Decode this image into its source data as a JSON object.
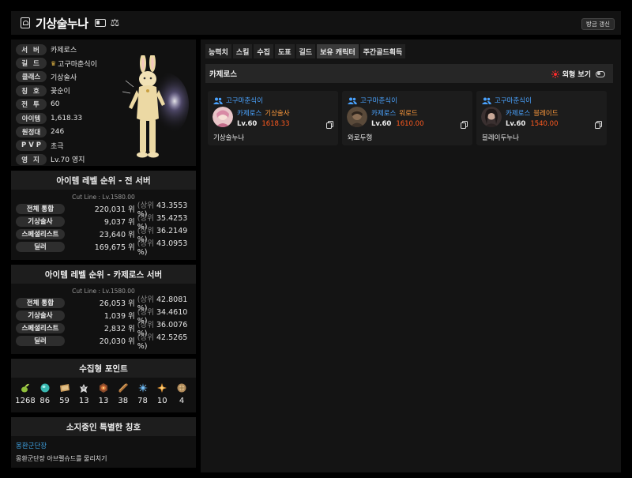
{
  "header": {
    "title": "기상술누나",
    "refresh_label": "방금 갱신"
  },
  "profile": {
    "rows": [
      {
        "label": "서 버",
        "value": "카제로스"
      },
      {
        "label": "길 드",
        "value": "고구마춘식이"
      },
      {
        "label": "클래스",
        "value": "기상술사"
      },
      {
        "label": "칭 호",
        "value": "꽃순이"
      },
      {
        "label": "전 투",
        "value": "60"
      },
      {
        "label": "아이템",
        "value": "1,618.33"
      },
      {
        "label": "원정대",
        "value": "246"
      },
      {
        "label": "P V P",
        "value": "초극"
      },
      {
        "label": "영 지",
        "value": "Lv.70 영지"
      }
    ]
  },
  "rank_all": {
    "title": "아이템 레벨 순위 - 전 서버",
    "cutline": "Cut Line : Lv.1580.00",
    "rows": [
      {
        "label": "전체 통합",
        "rank": "220,031 위",
        "pct_prefix": "(상위",
        "pct": "43.3553 %)"
      },
      {
        "label": "기상술사",
        "rank": "9,037 위",
        "pct_prefix": "(상위",
        "pct": "35.4253 %)"
      },
      {
        "label": "스페셜리스트",
        "rank": "23,640 위",
        "pct_prefix": "(상위",
        "pct": "36.2149 %)"
      },
      {
        "label": "딜러",
        "rank": "169,675 위",
        "pct_prefix": "(상위",
        "pct": "43.0953 %)"
      }
    ]
  },
  "rank_server": {
    "title": "아이템 레벨 순위 - 카제로스 서버",
    "cutline": "Cut Line : Lv.1580.00",
    "rows": [
      {
        "label": "전체 통합",
        "rank": "26,053 위",
        "pct_prefix": "(상위",
        "pct": "42.8081 %)"
      },
      {
        "label": "기상술사",
        "rank": "1,039 위",
        "pct_prefix": "(상위",
        "pct": "34.4610 %)"
      },
      {
        "label": "스페셜리스트",
        "rank": "2,832 위",
        "pct_prefix": "(상위",
        "pct": "36.0076 %)"
      },
      {
        "label": "딜러",
        "rank": "20,030 위",
        "pct_prefix": "(상위",
        "pct": "42.5265 %)"
      }
    ]
  },
  "collection": {
    "title": "수집형 포인트",
    "items": [
      {
        "icon": "mokoko-seed-icon",
        "count": "1268"
      },
      {
        "icon": "island-heart-icon",
        "count": "86"
      },
      {
        "icon": "great-art-icon",
        "count": "59"
      },
      {
        "icon": "giant-heart-icon",
        "count": "13"
      },
      {
        "icon": "ignea-token-icon",
        "count": "13"
      },
      {
        "icon": "adventure-book-icon",
        "count": "38"
      },
      {
        "icon": "voyage-leaf-icon",
        "count": "78"
      },
      {
        "icon": "world-tree-leaf-icon",
        "count": "10"
      },
      {
        "icon": "orpheus-star-icon",
        "count": "4"
      }
    ]
  },
  "special_title": {
    "title": "소지중인 특별한 칭호",
    "name": "몽환군단장",
    "desc": "몽환군단장 아브렐슈드를 물리치기"
  },
  "tabs": [
    "능력치",
    "스킬",
    "수집",
    "도표",
    "길드",
    "보유 캐릭터",
    "주간골드획득"
  ],
  "active_tab": 5,
  "roster": {
    "server": "카제로스",
    "appearance_label": "외형 보기",
    "characters": [
      {
        "guild": "고구마춘식이",
        "server": "카제로스",
        "class": "기상술사",
        "level": "Lv.60",
        "item_level": "1618.33",
        "name": "기상술누나"
      },
      {
        "guild": "고구마춘식이",
        "server": "카제로스",
        "class": "워로드",
        "level": "Lv.60",
        "item_level": "1610.00",
        "name": "와로두형"
      },
      {
        "guild": "고구마춘식이",
        "server": "카제로스",
        "class": "블레이드",
        "level": "Lv.60",
        "item_level": "1540.00",
        "name": "블레이두누나"
      }
    ]
  },
  "colors": {
    "accent_blue": "#4aa3ff",
    "class_orange": "#ff9a3c",
    "item_level_red": "#ff5a1f",
    "title_blue": "#3ea0e0"
  }
}
